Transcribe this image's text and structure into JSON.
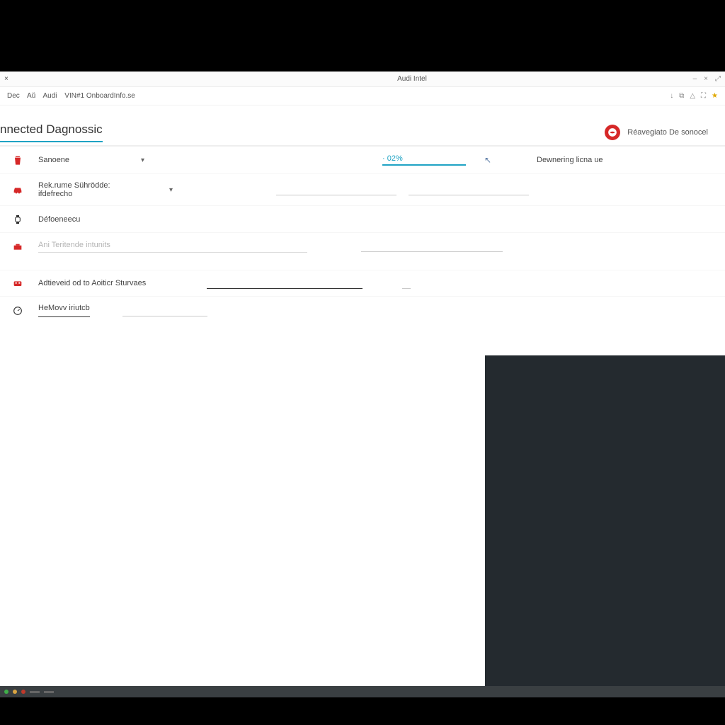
{
  "titlebar": {
    "left_tokens": [
      "×",
      "",
      ""
    ],
    "center": "Audi Intel",
    "window_controls": [
      "–",
      "×",
      "⤢"
    ]
  },
  "secondbar": {
    "crumbs": [
      "Dec",
      "Aŭ",
      "Audi",
      "VIN#1 OnboardInfo.se"
    ],
    "right_icons": [
      "↓",
      "⧉",
      "△",
      "⛶",
      "★"
    ]
  },
  "header": {
    "title": "nnected Dagnossic",
    "action_label": "Réavegiato De sonocel"
  },
  "rows": {
    "r1": {
      "select_label": "Sanoene",
      "mid_value": "· 02%",
      "right_label": "Dewnering licna ue"
    },
    "r2": {
      "select_label": "Rek.rume Sührödde: ifdefrecho"
    },
    "r3": {
      "label": "Défoeneecu"
    },
    "r4": {
      "placeholder": "Ani Teritende intunits"
    },
    "r5": {
      "label": "Adtieveid od to Aoiticr Sturvaes"
    },
    "r6": {
      "label": "HeMovv iriutcb"
    }
  }
}
